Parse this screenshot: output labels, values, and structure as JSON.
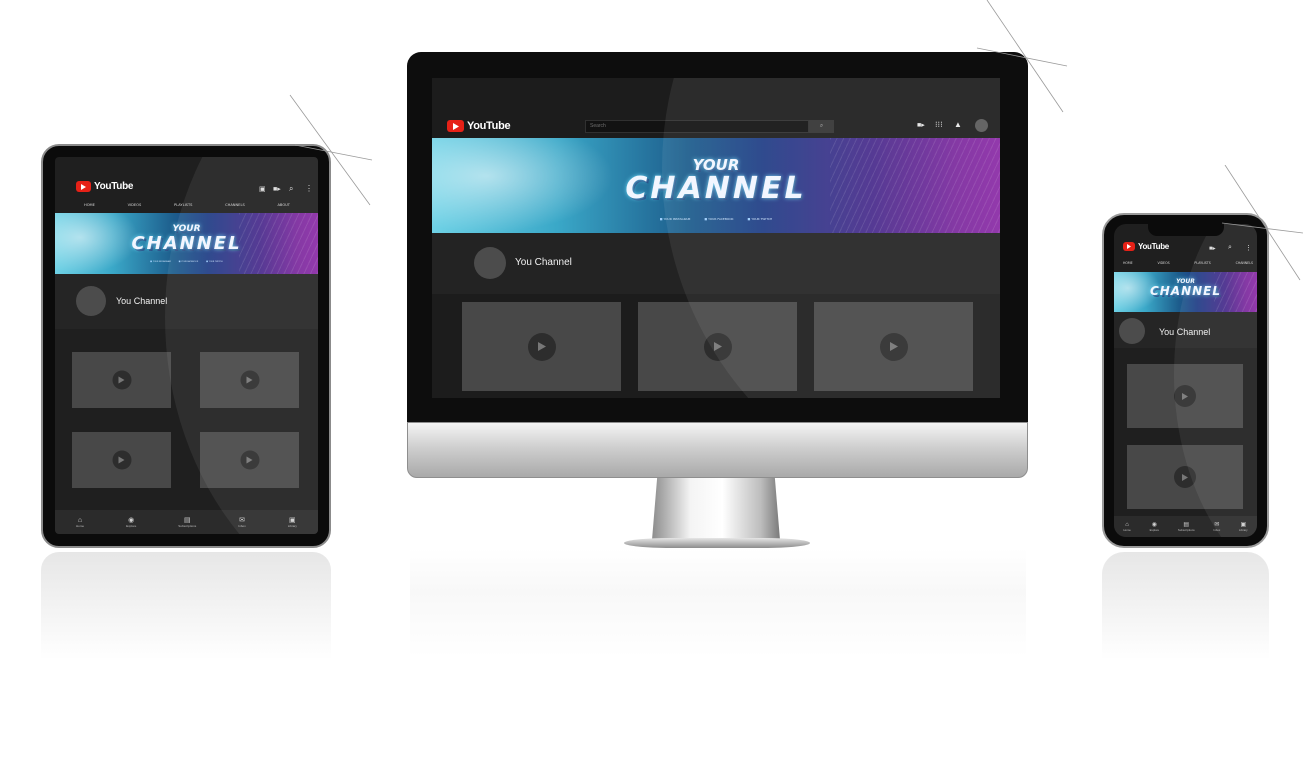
{
  "brand": {
    "logo_text": "YouTube",
    "accent_color": "#e62117"
  },
  "channel": {
    "name": "You Channel"
  },
  "banner": {
    "line1": "YOUR",
    "line2": "CHANNEL",
    "socials": [
      "YOUR INSTAGRAM",
      "YOUR FACEBOOK",
      "YOUR TWITCH"
    ]
  },
  "desktop": {
    "search_placeholder": "Search"
  },
  "tabs": [
    "HOME",
    "VIDEOS",
    "PLAYLISTS",
    "CHANNELS",
    "ABOUT"
  ],
  "bottom_nav": [
    "Home",
    "Explore",
    "Subscriptions",
    "Inbox",
    "Library"
  ],
  "icons": {
    "cast": "cast-icon",
    "camera": "video-camera-icon",
    "search": "search-icon",
    "more": "more-vert-icon",
    "apps": "apps-grid-icon",
    "bell": "bell-icon",
    "home": "home-icon",
    "explore": "compass-icon",
    "subs": "subscriptions-icon",
    "inbox": "inbox-icon",
    "library": "library-icon",
    "play": "play-icon"
  }
}
